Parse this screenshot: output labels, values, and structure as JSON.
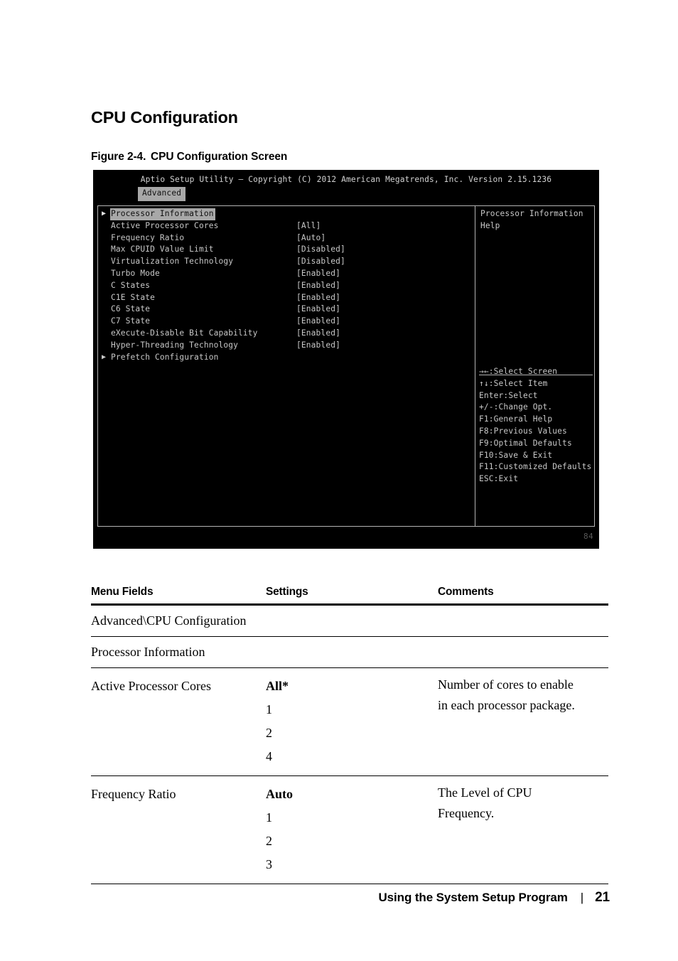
{
  "page": {
    "section_title": "CPU Configuration",
    "figure_number": "Figure 2-4.",
    "figure_title": "CPU Configuration Screen"
  },
  "bios": {
    "title_bar": "Aptio Setup Utility – Copyright (C) 2012 American Megatrends, Inc.  Version 2.15.1236",
    "active_tab": "Advanced",
    "corner_code": "84",
    "menu_items": [
      {
        "arrow": "▶",
        "label": "Processor Information",
        "value": "",
        "selected": true
      },
      {
        "arrow": "",
        "label": "Active Processor Cores",
        "value": "[All]",
        "selected": false
      },
      {
        "arrow": "",
        "label": "Frequency Ratio",
        "value": "[Auto]",
        "selected": false
      },
      {
        "arrow": "",
        "label": "Max CPUID Value Limit",
        "value": "[Disabled]",
        "selected": false
      },
      {
        "arrow": "",
        "label": "Virtualization Technology",
        "value": "[Disabled]",
        "selected": false
      },
      {
        "arrow": "",
        "label": "Turbo Mode",
        "value": "[Enabled]",
        "selected": false
      },
      {
        "arrow": "",
        "label": "C States",
        "value": "[Enabled]",
        "selected": false
      },
      {
        "arrow": "",
        "label": "C1E State",
        "value": "[Enabled]",
        "selected": false
      },
      {
        "arrow": "",
        "label": "C6 State",
        "value": "[Enabled]",
        "selected": false
      },
      {
        "arrow": "",
        "label": "C7 State",
        "value": "[Enabled]",
        "selected": false
      },
      {
        "arrow": "",
        "label": "eXecute-Disable Bit Capability",
        "value": "[Enabled]",
        "selected": false
      },
      {
        "arrow": "",
        "label": "Hyper-Threading Technology",
        "value": "[Enabled]",
        "selected": false
      },
      {
        "arrow": "▶",
        "label": "Prefetch Configuration",
        "value": "",
        "selected": false
      }
    ],
    "help_lines": [
      "Processor Information",
      "Help"
    ],
    "key_legend": [
      "→←:Select Screen",
      "↑↓:Select Item",
      "Enter:Select",
      "+/-:Change Opt.",
      "F1:General Help",
      "F8:Previous Values",
      "F9:Optimal Defaults",
      "F10:Save & Exit",
      "F11:Customized Defaults",
      "ESC:Exit"
    ]
  },
  "table": {
    "headers": [
      "Menu Fields",
      "Settings",
      "Comments"
    ],
    "rows": [
      {
        "field": "Advanced\\CPU Configuration",
        "settings": [],
        "comments": [],
        "single": true
      },
      {
        "field": "Processor Information",
        "settings": [],
        "comments": [],
        "single": true
      },
      {
        "field": "Active Processor Cores",
        "settings": [
          {
            "text": "All*",
            "bold": true
          },
          {
            "text": "1",
            "bold": false
          },
          {
            "text": "2",
            "bold": false
          },
          {
            "text": "4",
            "bold": false
          }
        ],
        "comments": [
          "Number of cores to enable",
          "in each processor package."
        ],
        "single": false
      },
      {
        "field": "Frequency Ratio",
        "settings": [
          {
            "text": "Auto",
            "bold": true
          },
          {
            "text": "1",
            "bold": false
          },
          {
            "text": "2",
            "bold": false
          },
          {
            "text": "3",
            "bold": false
          }
        ],
        "comments": [
          "The Level of CPU",
          "Frequency."
        ],
        "single": false
      }
    ]
  },
  "footer": {
    "chapter": "Using the System Setup Program",
    "separator": "|",
    "page_number": "21"
  }
}
